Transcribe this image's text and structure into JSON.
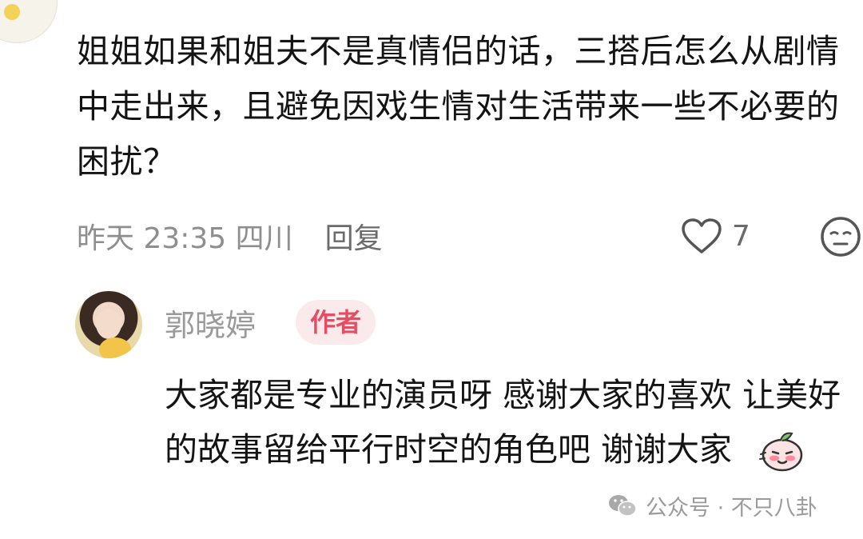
{
  "comment": {
    "text": "姐姐如果和姐夫不是真情侣的话，三搭后怎么从剧情中走出来，且避免因戏生情对生活带来一些不必要的困扰？",
    "time": "昨天 23:35",
    "location": "四川",
    "reply_label": "回复",
    "like_count": "7"
  },
  "reply": {
    "author": "郭晓婷",
    "badge": "作者",
    "text": "大家都是专业的演员呀 感谢大家的喜欢 让美好的故事留给平行时空的角色吧 谢谢大家"
  },
  "watermark": {
    "text": "公众号 · 不只八卦"
  },
  "icons": {
    "like": "heart-outline-icon",
    "emoji": "neutral-face-icon",
    "reply_emoji": "blushing-peach-sticker-icon",
    "watermark": "wechat-icon"
  }
}
